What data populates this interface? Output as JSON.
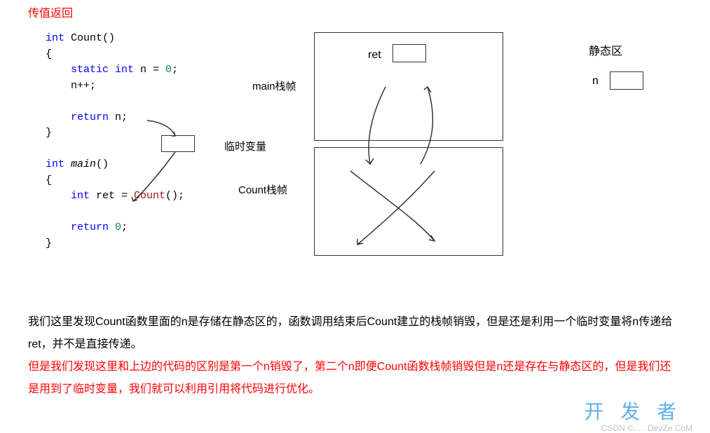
{
  "title": "传值返回",
  "code": {
    "l1_kw": "int",
    "l1_rest": " Count()",
    "l2": "{",
    "l3_kw1": "    static int",
    "l3_rest": " n = ",
    "l3_num": "0",
    "l3_end": ";",
    "l4": "    n++;",
    "l5": " ",
    "l6_kw": "    return",
    "l6_rest": " n;",
    "l7": "}",
    "l8": " ",
    "l9_kw": "int",
    "l9_main": " main",
    "l9_rest": "()",
    "l10": "{",
    "l11_kw": "    int",
    "l11_rest": " ret = ",
    "l11_fn": "Count",
    "l11_end": "();",
    "l12": " ",
    "l13_kw": "    return",
    "l13_rest": " ",
    "l13_num": "0",
    "l13_end": ";",
    "l14": "}"
  },
  "labels": {
    "main_frame": "main栈帧",
    "temp_var": "临时变量",
    "count_frame": "Count栈帧",
    "ret": "ret",
    "static_area": "静态区",
    "n": "n"
  },
  "para1": "我们这里发现Count函数里面的n是存储在静态区的，函数调用结束后Count建立的栈帧销毁，但是还是利用一个临时变量将n传递给ret，并不是直接传递。",
  "para2": "但是我们发现这里和上边的代码的区别是第一个n销毁了，第二个n即便Count函数栈帧销毁但是n还是存在与静态区的，但是我们还是用到了临时变量，我们就可以利用引用将代码进行优化。",
  "watermark1": "开 发 者",
  "watermark2": "CSDN ©..... DevZe.CoM"
}
